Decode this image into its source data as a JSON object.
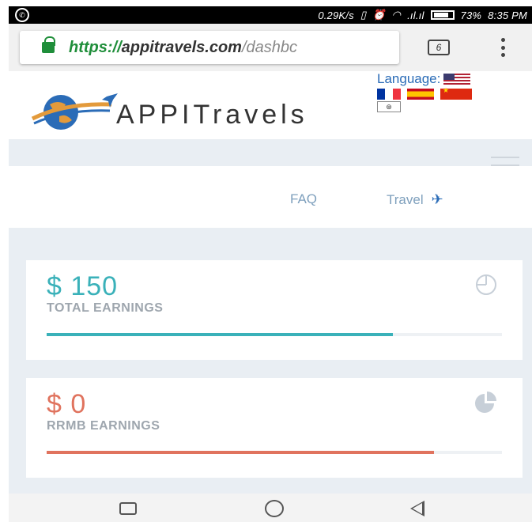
{
  "status_bar": {
    "speed": "0.29K/s",
    "battery": "73%",
    "time": "8:35 PM"
  },
  "browser": {
    "url_scheme": "https://",
    "url_host": "appitravels.com",
    "url_path": "/dashbc",
    "tab_count": "6"
  },
  "header": {
    "brand": "APPITravels",
    "language_label": "Language:"
  },
  "nav": {
    "faq": "FAQ",
    "travel": "Travel"
  },
  "cards": [
    {
      "amount": "$ 150",
      "label": "TOTAL EARNINGS",
      "progress": 0.76,
      "color": "#3ab1b9"
    },
    {
      "amount": "$ 0",
      "label": "RRMB EARNINGS",
      "progress": 0.85,
      "color": "#e0735e"
    }
  ],
  "icons": {
    "card1": "pie-chart-outline-icon",
    "card2": "pie-chart-filled-icon",
    "travel": "airplane-icon",
    "menu": "hamburger-menu-icon"
  }
}
